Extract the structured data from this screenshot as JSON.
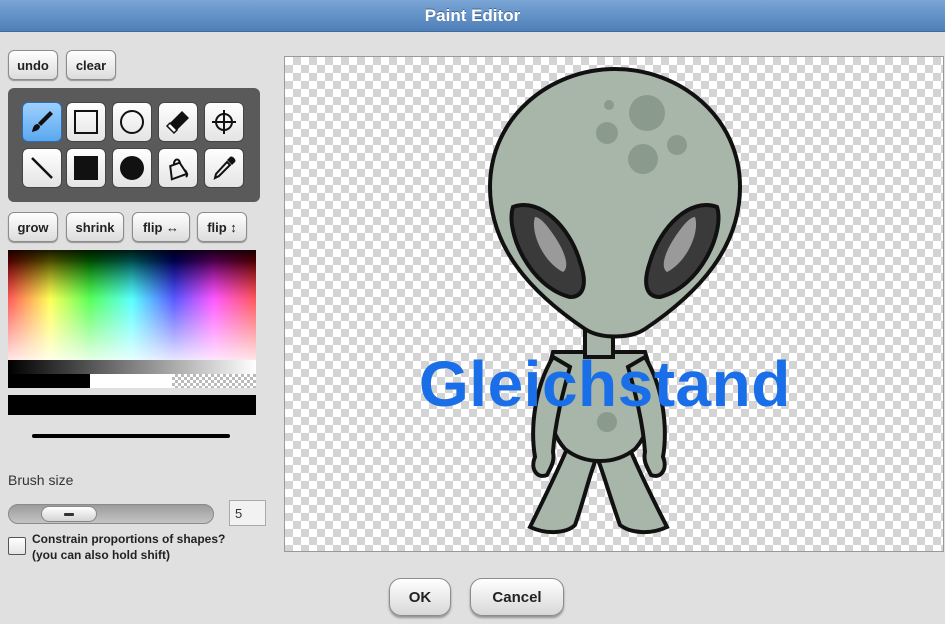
{
  "window": {
    "title": "Paint Editor"
  },
  "toolbar": {
    "undo_label": "undo",
    "clear_label": "clear"
  },
  "tools": [
    {
      "name": "brush-tool",
      "icon": "paintbrush-icon",
      "selected": true
    },
    {
      "name": "rectangle-tool",
      "icon": "rectangle-outline-icon",
      "selected": false
    },
    {
      "name": "ellipse-tool",
      "icon": "ellipse-outline-icon",
      "selected": false
    },
    {
      "name": "eraser-tool",
      "icon": "eraser-icon",
      "selected": false
    },
    {
      "name": "set-rotation-center-tool",
      "icon": "crosshair-icon",
      "selected": false
    },
    {
      "name": "line-tool",
      "icon": "line-icon",
      "selected": false
    },
    {
      "name": "filled-rectangle-tool",
      "icon": "filled-rectangle-icon",
      "selected": false
    },
    {
      "name": "filled-ellipse-tool",
      "icon": "filled-ellipse-icon",
      "selected": false
    },
    {
      "name": "paint-bucket-tool",
      "icon": "paint-bucket-icon",
      "selected": false
    },
    {
      "name": "eyedropper-tool",
      "icon": "eyedropper-icon",
      "selected": false
    }
  ],
  "transform": {
    "grow_label": "grow",
    "shrink_label": "shrink",
    "flip_h_label": "flip ↔",
    "flip_v_label": "flip ↕"
  },
  "colors": {
    "current": "#000000",
    "accent": "#4e7fb8",
    "canvas_text_color": "#1a6fe8"
  },
  "brush": {
    "label": "Brush size",
    "size": "5"
  },
  "constrain": {
    "line1": "Constrain proportions of shapes?",
    "line2": "(you can also hold shift)",
    "checked": false
  },
  "canvas": {
    "text": "Gleichstand"
  },
  "footer": {
    "ok_label": "OK",
    "cancel_label": "Cancel"
  }
}
